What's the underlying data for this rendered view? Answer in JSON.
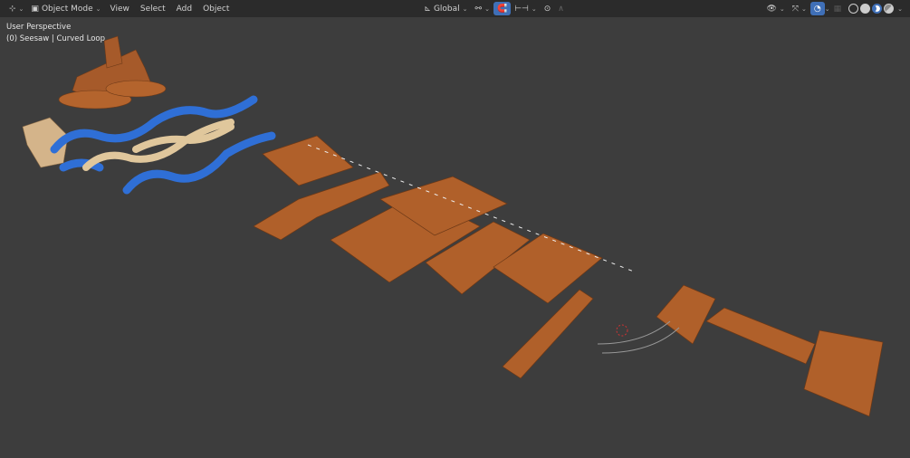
{
  "header": {
    "editor_type_icon": "viewport-editor-icon",
    "mode": "Object Mode",
    "menus": [
      "View",
      "Select",
      "Add",
      "Object"
    ],
    "transform_orientation": "Global",
    "pivot_icon": "pivot-icon",
    "snap_icon": "snap-icon",
    "proportional_icon": "proportional-edit-icon",
    "falloff_icon": "falloff-curve-icon",
    "visibility_icon": "eye-visibility-icon",
    "gizmo_icon": "gizmo-icon",
    "overlay_icon": "overlay-icon",
    "xray_icon": "xray-icon",
    "shading_modes": [
      "wireframe",
      "solid",
      "material-preview",
      "rendered"
    ],
    "active_shading": "material-preview",
    "accent_color": "#3f6fb7"
  },
  "viewport": {
    "view_name": "User Perspective",
    "object_info": "(0) Seesaw | Curved Loop",
    "background": "#3d3d3d",
    "wood_color": "#b0602a",
    "track_color": "#2f6fd6"
  }
}
